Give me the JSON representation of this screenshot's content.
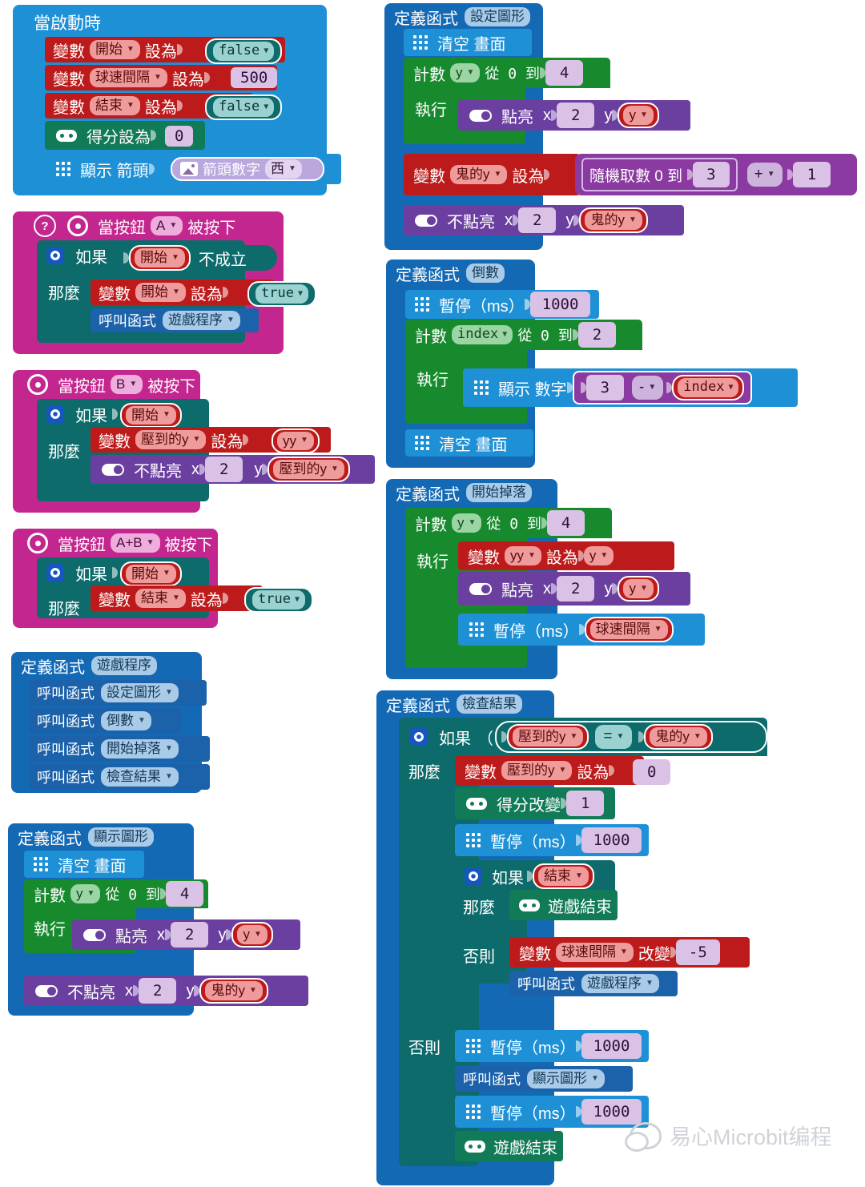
{
  "palette": {
    "event_blue": "#1e90d6",
    "variable_red": "#bd1b1b",
    "logic_teal": "#0e6b6b",
    "loop_green": "#178a2e",
    "math_purple": "#8a3aa0",
    "led_purple": "#6b3fa0",
    "game_green": "#117a57",
    "input_magenta": "#c4268f",
    "function_blue": "#1469b5",
    "canvas": "#ffffff"
  },
  "watermark": {
    "text": "易心Microbit编程",
    "icon": "wechat-icon"
  },
  "blocks": {
    "on_start": {
      "title": "當啟動時",
      "stmt1": {
        "kw": "變數",
        "var": "開始",
        "setto": "設為",
        "value": "false"
      },
      "stmt2": {
        "kw": "變數",
        "var": "球速間隔",
        "setto": "設為",
        "value": "500"
      },
      "stmt3": {
        "kw": "變數",
        "var": "結束",
        "setto": "設為",
        "value": "false"
      },
      "stmt4": {
        "label": "得分設為",
        "value": "0"
      },
      "stmt5": {
        "label": "顯示 箭頭",
        "inner_label": "箭頭數字",
        "inner_value": "西"
      }
    },
    "on_button_a": {
      "title_pre": "當按鈕",
      "button": "A",
      "title_post": "被按下",
      "if_label": "如果",
      "cond_var": "開始",
      "cond_not": "不成立",
      "then_label": "那麼",
      "set_kw": "變數",
      "set_var": "開始",
      "set_to": "設為",
      "set_value": "true",
      "call_label": "呼叫函式",
      "call_target": "遊戲程序"
    },
    "on_button_b": {
      "title_pre": "當按鈕",
      "button": "B",
      "title_post": "被按下",
      "if_label": "如果",
      "cond_var": "開始",
      "then_label": "那麼",
      "set_kw": "變數",
      "set_var": "壓到的y",
      "set_to": "設為",
      "set_value": "yy",
      "unplot_label": "不點亮",
      "x_label": "x",
      "x_value": "2",
      "y_label": "y",
      "y_value": "壓到的y"
    },
    "on_button_ab": {
      "title_pre": "當按鈕",
      "button": "A+B",
      "title_post": "被按下",
      "if_label": "如果",
      "cond_var": "開始",
      "then_label": "那麼",
      "set_kw": "變數",
      "set_var": "結束",
      "set_to": "設為",
      "set_value": "true"
    },
    "func_game_program": {
      "def_label": "定義函式",
      "name": "遊戲程序",
      "call_label": "呼叫函式",
      "calls": [
        "設定圖形",
        "倒數",
        "開始掉落",
        "檢查結果"
      ]
    },
    "func_show_shape": {
      "def_label": "定義函式",
      "name": "顯示圖形",
      "clear_label": "清空 畫面",
      "for_label": "計數",
      "for_var": "y",
      "for_from": "從 0 到",
      "for_to": "4",
      "do_label": "執行",
      "plot_label": "點亮",
      "x_label": "x",
      "x_value": "2",
      "y_label": "y",
      "y_value": "y",
      "unplot_label": "不點亮",
      "unplot_x": "2",
      "unplot_y": "鬼的y"
    },
    "func_set_shape": {
      "def_label": "定義函式",
      "name": "設定圖形",
      "clear_label": "清空 畫面",
      "for_label": "計數",
      "for_var": "y",
      "for_from": "從 0 到",
      "for_to": "4",
      "do_label": "執行",
      "plot_label": "點亮",
      "x_label": "x",
      "x_value": "2",
      "y_label": "y",
      "y_value": "y",
      "set_kw": "變數",
      "set_var": "鬼的y",
      "set_to": "設為",
      "rand_label": "隨機取數 0 到",
      "rand_max": "3",
      "op": "+",
      "op_right": "1",
      "unplot_label": "不點亮",
      "unplot_x": "2",
      "unplot_y": "鬼的y"
    },
    "func_countdown": {
      "def_label": "定義函式",
      "name": "倒數",
      "pause_label": "暫停（ms）",
      "pause_value": "1000",
      "for_label": "計數",
      "for_var": "index",
      "for_from": "從 0 到",
      "for_to": "2",
      "do_label": "執行",
      "show_label": "顯示 數字",
      "expr_left": "3",
      "expr_op": "-",
      "expr_right": "index",
      "clear_label": "清空 畫面"
    },
    "func_start_drop": {
      "def_label": "定義函式",
      "name": "開始掉落",
      "for_label": "計數",
      "for_var": "y",
      "for_from": "從 0 到",
      "for_to": "4",
      "do_label": "執行",
      "set_kw": "變數",
      "set_var": "yy",
      "set_to": "設為",
      "set_value": "y",
      "plot_label": "點亮",
      "x_label": "x",
      "x_value": "2",
      "y_label": "y",
      "y_value": "y",
      "pause_label": "暫停（ms）",
      "pause_value": "球速間隔"
    },
    "func_check_result": {
      "def_label": "定義函式",
      "name": "檢查結果",
      "if_label": "如果",
      "cond_left": "壓到的y",
      "cond_op": "=",
      "cond_right": "鬼的y",
      "then_label": "那麼",
      "set_kw": "變數",
      "set_var": "壓到的y",
      "set_to": "設為",
      "set_value": "0",
      "score_label": "得分改變",
      "score_value": "1",
      "pause_label": "暫停（ms）",
      "pause_value": "1000",
      "inner_if_label": "如果",
      "inner_cond": "結束",
      "inner_then_label": "那麼",
      "gameover_label": "遊戲結束",
      "inner_else_label": "否則",
      "chg_kw": "變數",
      "chg_var": "球速間隔",
      "chg_label": "改變",
      "chg_value": "-5",
      "call_label": "呼叫函式",
      "call_target": "遊戲程序",
      "else_label": "否則",
      "else_pause1_label": "暫停（ms）",
      "else_pause1_value": "1000",
      "else_call_label": "呼叫函式",
      "else_call_target": "顯示圖形",
      "else_pause2_label": "暫停（ms）",
      "else_pause2_value": "1000",
      "else_gameover_label": "遊戲結束"
    }
  }
}
